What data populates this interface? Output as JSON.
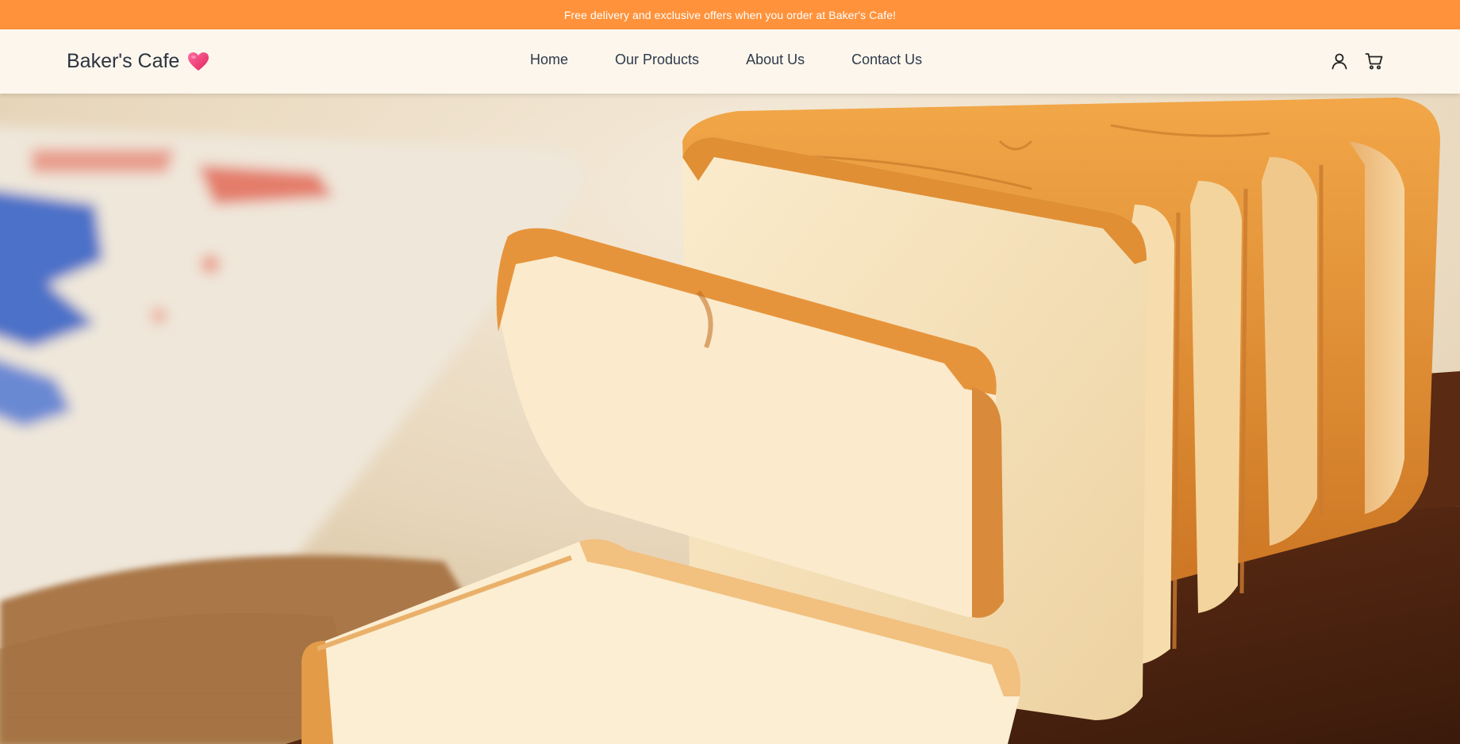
{
  "promo": {
    "text": "Free delivery and exclusive offers when you order at Baker's Cafe!"
  },
  "header": {
    "brand": "Baker's Cafe",
    "brand_icon": "heart-icon",
    "nav": [
      {
        "label": "Home"
      },
      {
        "label": "Our Products"
      },
      {
        "label": "About Us"
      },
      {
        "label": "Contact Us"
      }
    ],
    "icons": [
      "user-icon",
      "cart-icon"
    ]
  },
  "hero": {
    "image": "sliced-bread-loaf-photo"
  },
  "colors": {
    "promo_bg": "#ff923a",
    "nav_bg": "#fcf6ec",
    "heart": "#e8386b",
    "text": "#2f3a4a"
  }
}
